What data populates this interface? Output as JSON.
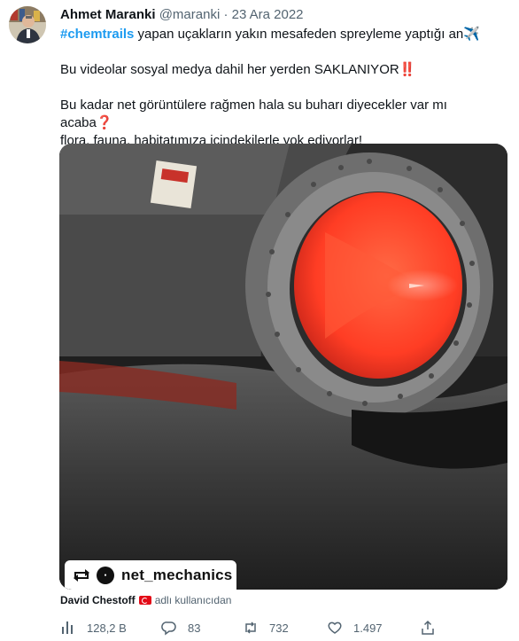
{
  "tweet": {
    "author_name": "Ahmet Maranki",
    "handle": "@maranki",
    "separator": "·",
    "date": "23 Ara 2022",
    "hashtag": "#chemtrails",
    "line1_rest": " yapan uçakların yakın mesafeden spreyleme yaptığı an",
    "line1_emoji": "✈️",
    "line2": "Bu videolar sosyal medya dahil her yerden SAKLANIYOR",
    "line2_emoji": "‼️",
    "line3": "Bu kadar net görüntülere rağmen hala su buharı diyecekler var mı acaba",
    "line3_emoji": "❓",
    "line4": "flora, fauna, habitatımıza içindekilerle yok ediyorlar!"
  },
  "media": {
    "watermark_text": "net_mechanics",
    "colors": {
      "nozzle_orange": "#ff4a2c",
      "body_dark": "#3a3a3a"
    }
  },
  "credit": {
    "name": "David Chestoff",
    "flag_icon": "turkey-flag-icon",
    "suffix": "adlı kullanıcıdan"
  },
  "actions": {
    "views": "128,2 B",
    "replies": "83",
    "retweets": "732",
    "likes": "1.497"
  }
}
